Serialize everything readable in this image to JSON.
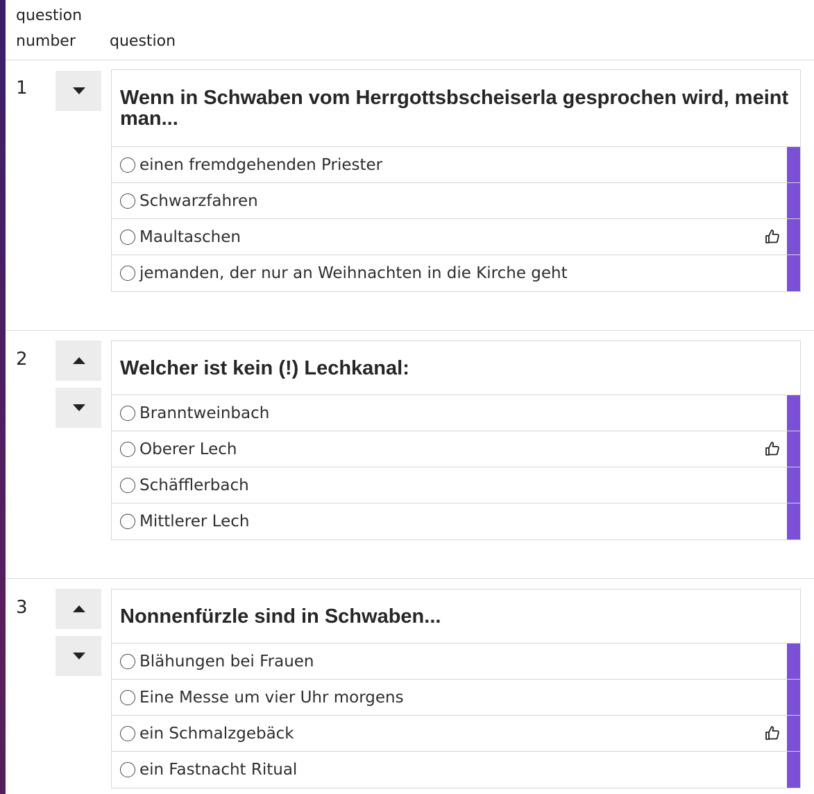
{
  "header": {
    "number_label_1": "question",
    "number_label_2": "number",
    "question_label": "question"
  },
  "questions": [
    {
      "number": "1",
      "text": "Wenn in Schwaben vom Herrgottsbscheiserla gesprochen wird, meint man...",
      "options": [
        {
          "label": "einen fremdgehenden Priester",
          "liked": false
        },
        {
          "label": "Schwarzfahren",
          "liked": false
        },
        {
          "label": "Maultaschen",
          "liked": true
        },
        {
          "label": "jemanden, der nur an Weihnachten in die Kirche geht",
          "liked": false
        }
      ]
    },
    {
      "number": "2",
      "text": "Welcher ist kein (!) Lechkanal:",
      "options": [
        {
          "label": "Branntweinbach",
          "liked": false
        },
        {
          "label": "Oberer Lech",
          "liked": true
        },
        {
          "label": "Schäfflerbach",
          "liked": false
        },
        {
          "label": "Mittlerer Lech",
          "liked": false
        }
      ]
    },
    {
      "number": "3",
      "text": "Nonnenfürzle sind in Schwaben...",
      "options": [
        {
          "label": "Blähungen bei Frauen",
          "liked": false
        },
        {
          "label": "Eine Messe um vier Uhr morgens",
          "liked": false
        },
        {
          "label": "ein Schmalzgebäck",
          "liked": true
        },
        {
          "label": "ein Fastnacht Ritual",
          "liked": false
        }
      ]
    }
  ],
  "colors": {
    "option_bar": "#7b4fd6"
  },
  "icons": {
    "move_up": "triangle-up-icon",
    "move_down": "triangle-down-icon",
    "liked": "thumbs-up-icon",
    "option": "radio-circle-icon"
  }
}
